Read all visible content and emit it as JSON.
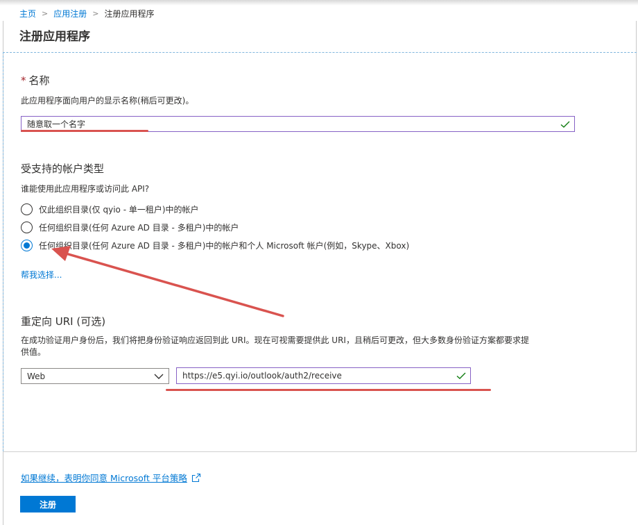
{
  "breadcrumb": {
    "home": "主页",
    "app_registrations": "应用注册",
    "current": "注册应用程序"
  },
  "page_title": "注册应用程序",
  "name_section": {
    "required_mark": "*",
    "title": "名称",
    "description": "此应用程序面向用户的显示名称(稍后可更改)。",
    "value": "随意取一个名字"
  },
  "account_types": {
    "title": "受支持的帐户类型",
    "question": "谁能使用此应用程序或访问此 API?",
    "options": [
      {
        "label": "仅此组织目录(仅 qyio - 单一租户)中的帐户",
        "checked": false
      },
      {
        "label": "任何组织目录(任何 Azure AD 目录 - 多租户)中的帐户",
        "checked": false
      },
      {
        "label": "任何组织目录(任何 Azure AD 目录 - 多租户)中的帐户和个人 Microsoft 帐户(例如，Skype、Xbox)",
        "checked": true
      }
    ],
    "help_link": "帮我选择..."
  },
  "redirect": {
    "title": "重定向 URI (可选)",
    "description_line1": "在成功验证用户身份后，我们将把身份验证响应返回到此 URI。现在可视需要提供此 URI，且稍后可更改，但大多数身份验证方案都要求提",
    "description_line2": "供值。",
    "platform": "Web",
    "uri": "https://e5.qyi.io/outlook/auth2/receive"
  },
  "footer": {
    "policy_link": "如果继续，表明你同意 Microsoft 平台策略",
    "register_label": "注册"
  },
  "icons": {
    "valid": "checkmark-icon",
    "dropdown": "chevron-down-icon",
    "external": "external-link-icon"
  },
  "colors": {
    "accent": "#0078d4",
    "valid_check": "#107c10",
    "focus_border": "#8661c5",
    "annotation": "#d9534f"
  }
}
